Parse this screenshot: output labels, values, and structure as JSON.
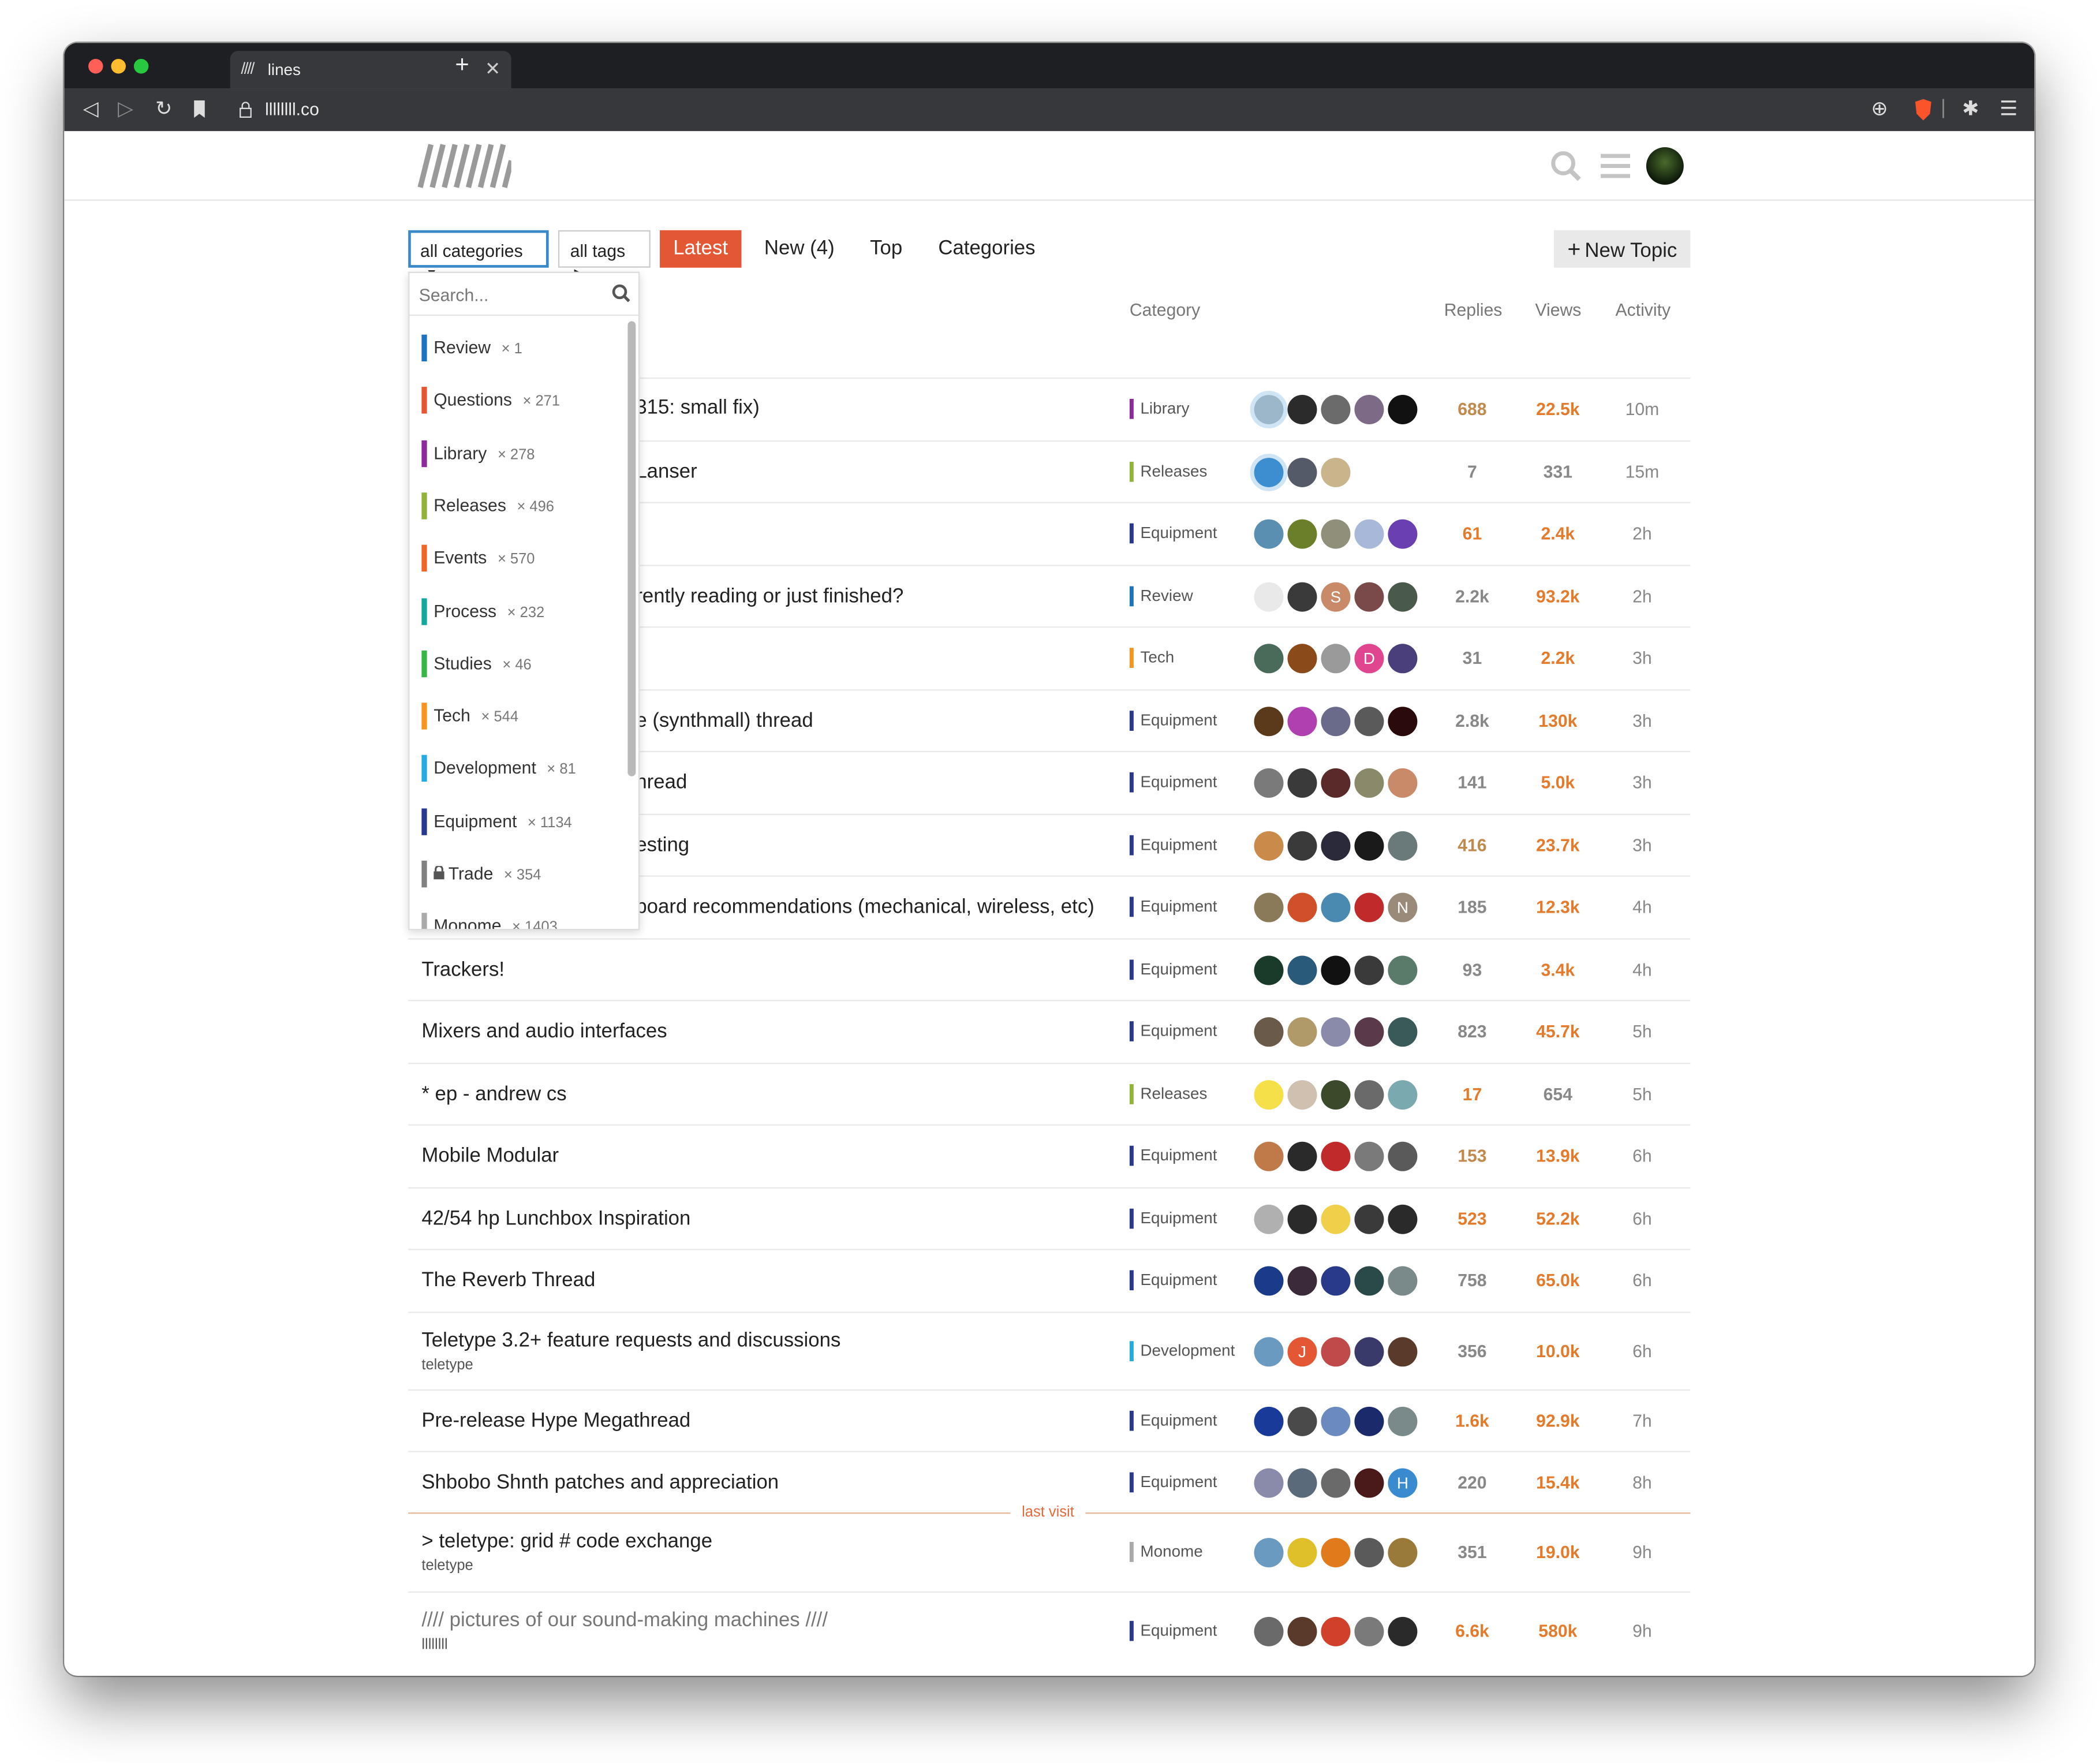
{
  "browser": {
    "tab_title": "lines",
    "tab_icon": "////",
    "url": "llllllll.co",
    "colors": {
      "close": "#ff5f57",
      "minimize": "#febc2e",
      "zoom": "#28c840",
      "brave": "#fb542b"
    }
  },
  "header": {
    "logo_alt": "lines logo"
  },
  "nav": {
    "categories_filter": "all categories",
    "tags_filter": "all tags",
    "latest": "Latest",
    "new": "New (4)",
    "top": "Top",
    "categories": "Categories",
    "new_topic": "New Topic",
    "accent": "#e45735"
  },
  "columns": {
    "category": "Category",
    "replies": "Replies",
    "views": "Views",
    "activity": "Activity"
  },
  "dropdown": {
    "search_placeholder": "Search...",
    "items": [
      {
        "name": "Review",
        "count": "× 1",
        "color": "#1e73be"
      },
      {
        "name": "Questions",
        "count": "× 271",
        "color": "#e45735"
      },
      {
        "name": "Library",
        "count": "× 278",
        "color": "#8c2a9c"
      },
      {
        "name": "Releases",
        "count": "× 496",
        "color": "#92b33a"
      },
      {
        "name": "Events",
        "count": "× 570",
        "color": "#f06529"
      },
      {
        "name": "Process",
        "count": "× 232",
        "color": "#12a89d"
      },
      {
        "name": "Studies",
        "count": "× 46",
        "color": "#3ab54a"
      },
      {
        "name": "Tech",
        "count": "× 544",
        "color": "#f7941d"
      },
      {
        "name": "Development",
        "count": "× 81",
        "color": "#25aae1"
      },
      {
        "name": "Equipment",
        "count": "× 1134",
        "color": "#283890"
      },
      {
        "name": "Trade",
        "count": "× 354",
        "color": "#808281"
      },
      {
        "name": "Monome",
        "count": "× 1403",
        "color": "#aaaaaa"
      }
    ]
  },
  "topics": [
    {
      "title": "315: small fix)",
      "category": "Library",
      "cat_color": "#8c2a9c",
      "replies": "688",
      "views": "22.5k",
      "activity": "10m",
      "rh": 1,
      "vh": 2
    },
    {
      "title": "Lanser",
      "category": "Releases",
      "cat_color": "#92b33a",
      "replies": "7",
      "views": "331",
      "activity": "15m",
      "rh": 0,
      "vh": 0
    },
    {
      "title": "",
      "category": "Equipment",
      "cat_color": "#283890",
      "replies": "61",
      "views": "2.4k",
      "activity": "2h",
      "rh": 2,
      "vh": 2
    },
    {
      "title": "rently reading or just finished?",
      "category": "Review",
      "cat_color": "#1e73be",
      "replies": "2.2k",
      "views": "93.2k",
      "activity": "2h",
      "rh": 0,
      "vh": 2
    },
    {
      "title": "",
      "category": "Tech",
      "cat_color": "#f7941d",
      "replies": "31",
      "views": "2.2k",
      "activity": "3h",
      "rh": 0,
      "vh": 2
    },
    {
      "title": "e (synthmall) thread",
      "category": "Equipment",
      "cat_color": "#283890",
      "replies": "2.8k",
      "views": "130k",
      "activity": "3h",
      "rh": 0,
      "vh": 2
    },
    {
      "title": "nread",
      "category": "Equipment",
      "cat_color": "#283890",
      "replies": "141",
      "views": "5.0k",
      "activity": "3h",
      "rh": 0,
      "vh": 2
    },
    {
      "title": "esting",
      "category": "Equipment",
      "cat_color": "#283890",
      "replies": "416",
      "views": "23.7k",
      "activity": "3h",
      "rh": 1,
      "vh": 2
    },
    {
      "title": "board recommendations (mechanical, wireless, etc)",
      "category": "Equipment",
      "cat_color": "#283890",
      "replies": "185",
      "views": "12.3k",
      "activity": "4h",
      "rh": 0,
      "vh": 2
    },
    {
      "title": "Trackers!",
      "category": "Equipment",
      "cat_color": "#283890",
      "replies": "93",
      "views": "3.4k",
      "activity": "4h",
      "rh": 0,
      "vh": 2
    },
    {
      "title": "Mixers and audio interfaces",
      "category": "Equipment",
      "cat_color": "#283890",
      "replies": "823",
      "views": "45.7k",
      "activity": "5h",
      "rh": 0,
      "vh": 2
    },
    {
      "title": "* ep - andrew cs",
      "category": "Releases",
      "cat_color": "#92b33a",
      "replies": "17",
      "views": "654",
      "activity": "5h",
      "rh": 2,
      "vh": 0
    },
    {
      "title": "Mobile Modular",
      "category": "Equipment",
      "cat_color": "#283890",
      "replies": "153",
      "views": "13.9k",
      "activity": "6h",
      "rh": 1,
      "vh": 2
    },
    {
      "title": "42/54 hp Lunchbox Inspiration",
      "category": "Equipment",
      "cat_color": "#283890",
      "replies": "523",
      "views": "52.2k",
      "activity": "6h",
      "rh": 2,
      "vh": 2
    },
    {
      "title": "The Reverb Thread",
      "category": "Equipment",
      "cat_color": "#283890",
      "replies": "758",
      "views": "65.0k",
      "activity": "6h",
      "rh": 0,
      "vh": 2
    },
    {
      "title": "Teletype 3.2+ feature requests and discussions",
      "tag": "teletype",
      "category": "Development",
      "cat_color": "#25aae1",
      "replies": "356",
      "views": "10.0k",
      "activity": "6h",
      "rh": 0,
      "vh": 2
    },
    {
      "title": "Pre-release Hype Megathread",
      "category": "Equipment",
      "cat_color": "#283890",
      "replies": "1.6k",
      "views": "92.9k",
      "activity": "7h",
      "rh": 2,
      "vh": 2
    },
    {
      "title": "Shbobo Shnth patches and appreciation",
      "category": "Equipment",
      "cat_color": "#283890",
      "replies": "220",
      "views": "15.4k",
      "activity": "8h",
      "rh": 0,
      "vh": 2
    },
    {
      "title": "> teletype: grid # code exchange",
      "tag": "teletype",
      "category": "Monome",
      "cat_color": "#aaaaaa",
      "replies": "351",
      "views": "19.0k",
      "activity": "9h",
      "rh": 0,
      "vh": 2
    },
    {
      "title": "//// pictures of our sound-making machines ////",
      "tag": "llllllll",
      "category": "Equipment",
      "cat_color": "#283890",
      "replies": "6.6k",
      "views": "580k",
      "activity": "9h",
      "rh": 2,
      "vh": 2,
      "muted": true
    }
  ],
  "last_visit_label": "last visit",
  "poster_colors": [
    [
      "#9cb7c9",
      "#2b2b2b",
      "#6b6b6b",
      "#7c6a86",
      "#111111"
    ],
    [
      "#3d8ed0",
      "#555a68",
      "#c9b48b"
    ],
    [
      "#5a8fb1",
      "#6b7f2a",
      "#8f8f7a",
      "#a8b8d8",
      "#6a3fb0"
    ],
    [
      "#e9e9e9",
      "#3a3a3a",
      "#c98a6a",
      "#7a4a4a",
      "#4a5a4a"
    ],
    [
      "#4a6b5a",
      "#8a4a1a",
      "#9a9a9a",
      "#e0468f",
      "#4a3f7a"
    ],
    [
      "#5a3a1a",
      "#b03fb0",
      "#6a6a8a",
      "#5a5a5a",
      "#2a0a0a"
    ],
    [
      "#7a7a7a",
      "#3a3a3a",
      "#5a2a2a",
      "#8a8a6a",
      "#c98a6a"
    ],
    [
      "#c98a4a",
      "#3a3a3a",
      "#2a2a3a",
      "#1a1a1a",
      "#6a7a7a"
    ],
    [
      "#8a7a5a",
      "#d0502a",
      "#4a8ab0",
      "#c02a2a",
      "#9a8a7a"
    ],
    [
      "#1a3a2a",
      "#2a5a7a",
      "#111111",
      "#3a3a3a",
      "#5a7a6a"
    ],
    [
      "#6a5a4a",
      "#b09a6a",
      "#8a8aaa",
      "#5a3a4a",
      "#3a5a5a"
    ],
    [
      "#f5e04a",
      "#d0c0b0",
      "#3a4a2a",
      "#6a6a6a",
      "#7aaab0"
    ],
    [
      "#c07a4a",
      "#2a2a2a",
      "#c02a2a",
      "#7a7a7a",
      "#5a5a5a"
    ],
    [
      "#b0b0b0",
      "#2a2a2a",
      "#f0d04a",
      "#3a3a3a",
      "#2a2a2a"
    ],
    [
      "#1a3a8a",
      "#3a2a3a",
      "#2a3a8a",
      "#2a4a4a",
      "#7a8a8a"
    ],
    [
      "#6a9ac0",
      "#e45735",
      "#c04a4a",
      "#3a3a6a",
      "#5a3a2a"
    ],
    [
      "#1a3a9a",
      "#4a4a4a",
      "#6a8ac0",
      "#1a2a6a",
      "#7a8a8a"
    ],
    [
      "#8a8aaa",
      "#5a6a7a",
      "#6a6a6a",
      "#4a1a1a",
      "#3a8ad0"
    ],
    [
      "#6a9ac0",
      "#e0c02a",
      "#e07a1a",
      "#5a5a5a",
      "#9a7a3a"
    ],
    [
      "#6a6a6a",
      "#5a3a2a",
      "#d0402a",
      "#7a7a7a",
      "#2a2a2a"
    ]
  ],
  "poster_letters": {
    "3_2": "S",
    "4_3": "D",
    "8_4": "N",
    "15_1": "J",
    "17_4": "H"
  }
}
